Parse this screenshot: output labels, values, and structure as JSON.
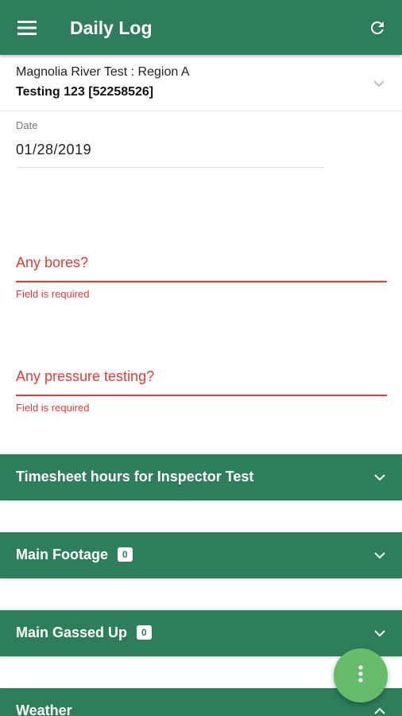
{
  "appbar": {
    "title": "Daily Log",
    "menu_icon": "hamburger-menu-icon",
    "refresh_icon": "refresh-icon"
  },
  "project": {
    "name": "Magnolia River Test : Region A",
    "job": "Testing 123 [52258526]",
    "icon": "chevron-down-icon"
  },
  "date_field": {
    "label": "Date",
    "value": "01/28/2019"
  },
  "questions": [
    {
      "label": "Any bores?",
      "error": "Field is required"
    },
    {
      "label": "Any pressure testing?",
      "error": "Field is required"
    }
  ],
  "sections": [
    {
      "title": "Timesheet hours for Inspector Test",
      "badge": "",
      "expanded": false
    },
    {
      "title": "Main Footage",
      "badge": "0",
      "expanded": false
    },
    {
      "title": "Main Gassed Up",
      "badge": "0",
      "expanded": false
    },
    {
      "title": "Weather",
      "badge": "",
      "expanded": true
    }
  ],
  "fab": {
    "icon": "more-vertical-icon"
  },
  "colors": {
    "primary": "#2e7d5b",
    "error": "#e53935",
    "fab": "#66bb6a"
  }
}
